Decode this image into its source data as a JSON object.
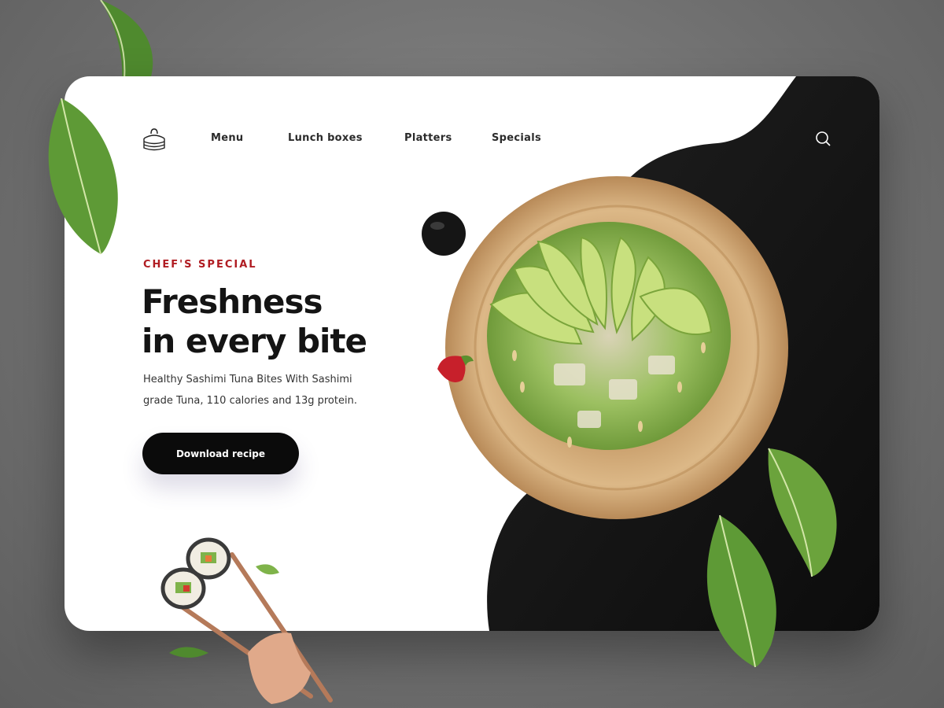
{
  "nav": {
    "items": [
      "Menu",
      "Lunch boxes",
      "Platters",
      "Specials"
    ]
  },
  "hero": {
    "eyebrow": "CHEF'S SPECIAL",
    "headline_line1": "Freshness",
    "headline_line2": "in every bite",
    "description": "Healthy Sashimi Tuna Bites With Sashimi grade Tuna, 110 calories and 13g protein.",
    "cta_label": "Download recipe"
  },
  "icons": {
    "logo": "dumpling-steamer-icon",
    "search": "search-icon"
  },
  "colors": {
    "background": "#6e6e6e",
    "card": "#ffffff",
    "dark_panel": "#141414",
    "accent": "#b01c22",
    "button": "#0b0b0b",
    "text": "#141414"
  }
}
